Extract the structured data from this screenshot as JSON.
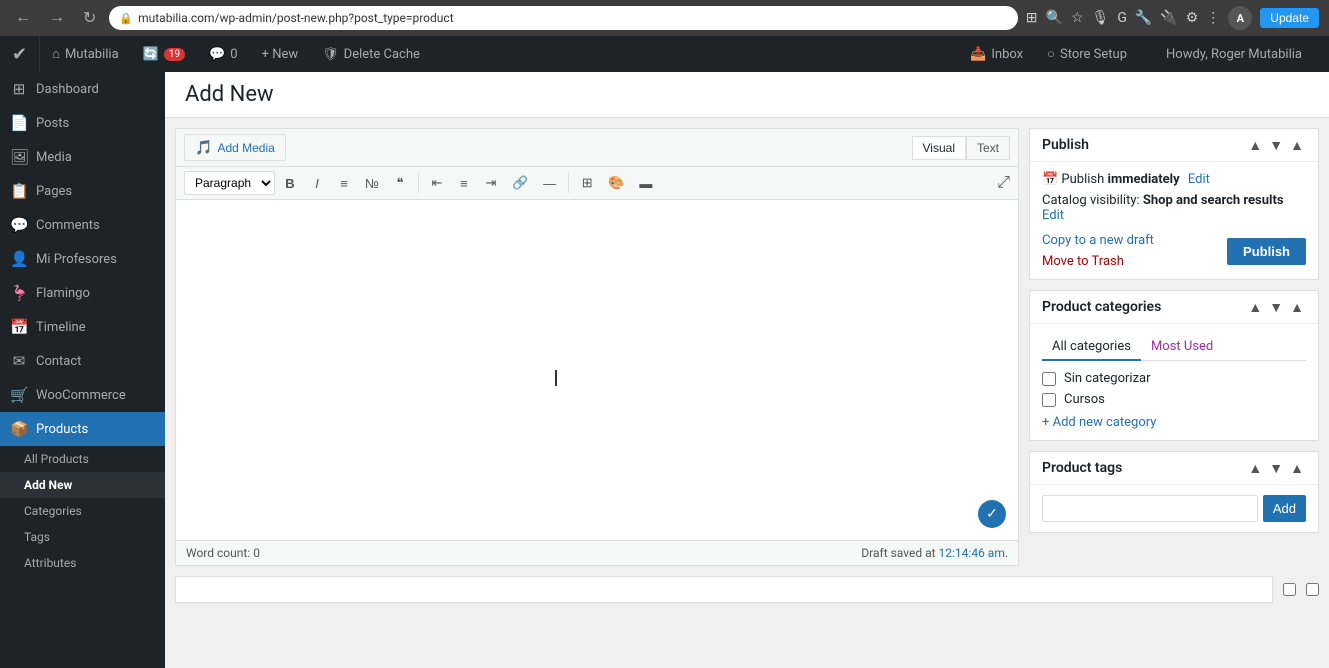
{
  "browser": {
    "url": "mutabilia.com/wp-admin/post-new.php?post_type=product",
    "update_label": "Update",
    "avatar_initial": "A"
  },
  "admin_bar": {
    "logo": "W",
    "site_name": "Mutabilia",
    "updates_count": "19",
    "comments_icon": "💬",
    "comments_count": "0",
    "new_label": "+ New",
    "cache_label": "Delete Cache",
    "howdy": "Howdy, Roger Mutabilia"
  },
  "sidebar": {
    "items": [
      {
        "label": "Dashboard",
        "icon": "⊞",
        "id": "dashboard"
      },
      {
        "label": "Posts",
        "icon": "📄",
        "id": "posts"
      },
      {
        "label": "Media",
        "icon": "🖼",
        "id": "media"
      },
      {
        "label": "Pages",
        "icon": "📋",
        "id": "pages"
      },
      {
        "label": "Comments",
        "icon": "💬",
        "id": "comments"
      },
      {
        "label": "Mi Profesores",
        "icon": "👤",
        "id": "mi-profesores"
      },
      {
        "label": "Flamingo",
        "icon": "🦩",
        "id": "flamingo"
      },
      {
        "label": "Timeline",
        "icon": "📅",
        "id": "timeline"
      },
      {
        "label": "Contact",
        "icon": "✉",
        "id": "contact"
      },
      {
        "label": "WooCommerce",
        "icon": "🛒",
        "id": "woocommerce"
      },
      {
        "label": "Products",
        "icon": "📦",
        "id": "products-menu"
      },
      {
        "label": "All Products",
        "sub": true,
        "id": "all-products"
      },
      {
        "label": "Add New",
        "sub": true,
        "id": "add-new",
        "active": true
      },
      {
        "label": "Categories",
        "sub": true,
        "id": "categories"
      },
      {
        "label": "Tags",
        "sub": true,
        "id": "tags"
      },
      {
        "label": "Attributes",
        "sub": true,
        "id": "attributes"
      }
    ]
  },
  "page": {
    "title": "Add New"
  },
  "editor": {
    "add_media_label": "Add Media",
    "visual_tab": "Visual",
    "text_tab": "Text",
    "paragraph_select": "Paragraph",
    "word_count_label": "Word count:",
    "word_count_value": "0",
    "draft_status": "Draft saved at",
    "draft_time": "12:14:46 am."
  },
  "publish_panel": {
    "title": "Publish",
    "publish_label": "Publish",
    "visibility_label": "Publish",
    "publish_when": "immediately",
    "edit_link": "Edit",
    "catalog_label": "Catalog visibility:",
    "catalog_value": "Shop and search results",
    "catalog_edit": "Edit",
    "copy_draft": "Copy to a new draft",
    "move_trash": "Move to Trash",
    "controls": [
      "▲",
      "▼",
      "▲"
    ]
  },
  "categories_panel": {
    "title": "Product categories",
    "all_tab": "All categories",
    "most_used_tab": "Most Used",
    "items": [
      {
        "label": "Sin categorizar",
        "checked": false
      },
      {
        "label": "Cursos",
        "checked": false
      }
    ],
    "add_new_link": "+ Add new category"
  },
  "tags_panel": {
    "title": "Product tags",
    "input_placeholder": "",
    "add_label": "Add"
  }
}
